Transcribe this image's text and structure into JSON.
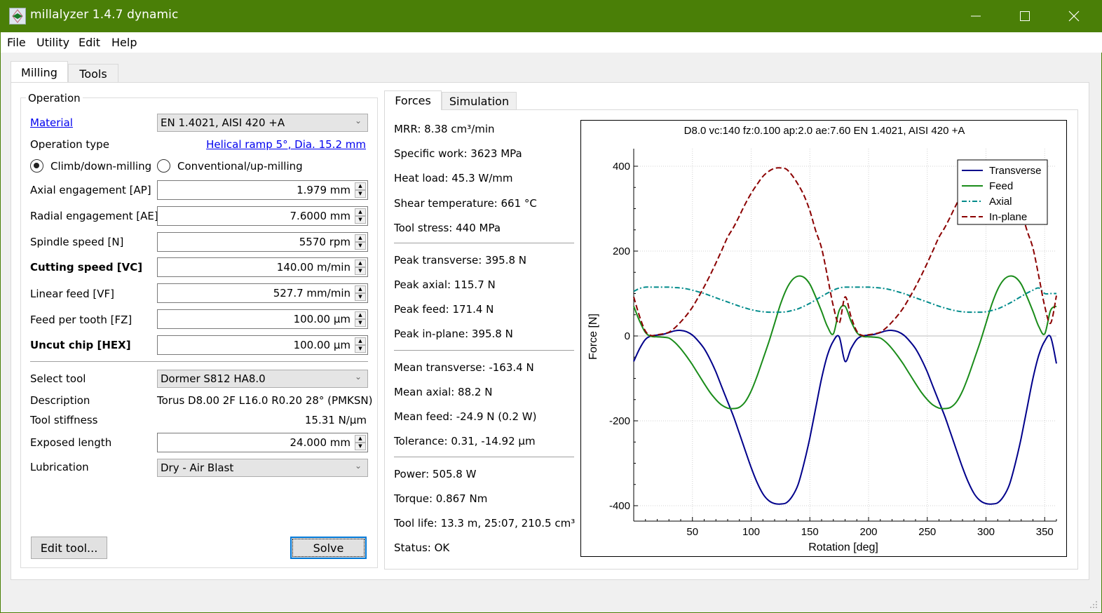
{
  "window": {
    "title": "millalyzer 1.4.7 dynamic",
    "controls": [
      "minimize",
      "maximize",
      "close"
    ]
  },
  "menu": [
    "File",
    "Utility",
    "Edit",
    "Help"
  ],
  "main_tabs": [
    {
      "label": "Milling",
      "active": true
    },
    {
      "label": "Tools",
      "active": false
    }
  ],
  "operation": {
    "group_title": "Operation",
    "material_label": "Material",
    "material_value": "EN 1.4021, AISI 420 +A",
    "operation_type_label": "Operation type",
    "operation_type_link": "Helical ramp 5°, Dia. 15.2 mm",
    "radios": [
      {
        "label": "Climb/down-milling",
        "checked": true
      },
      {
        "label": "Conventional/up-milling",
        "checked": false
      }
    ],
    "fields": [
      {
        "label": "Axial engagement [AP]",
        "value": "1.979 mm",
        "bold": false
      },
      {
        "label": "Radial engagement [AE]",
        "value": "7.6000 mm",
        "bold": false
      },
      {
        "label": "Spindle speed [N]",
        "value": "5570 rpm",
        "bold": false
      },
      {
        "label": "Cutting speed [VC]",
        "value": "140.00 m/min",
        "bold": true
      },
      {
        "label": "Linear feed [VF]",
        "value": "527.7 mm/min",
        "bold": false
      },
      {
        "label": "Feed per tooth [FZ]",
        "value": "100.00 µm",
        "bold": false
      },
      {
        "label": "Uncut chip [HEX]",
        "value": "100.00 µm",
        "bold": true
      }
    ],
    "select_tool_label": "Select tool",
    "select_tool_value": "Dormer S812 HA8.0",
    "description_label": "Description",
    "description_value": "Torus D8.00 2F L16.0 R0.20 28° (PMKSN)",
    "stiffness_label": "Tool stiffness",
    "stiffness_value": "15.31 N/µm",
    "exposed_label": "Exposed length",
    "exposed_value": "24.000 mm",
    "lubrication_label": "Lubrication",
    "lubrication_value": "Dry - Air Blast",
    "edit_tool_button": "Edit tool...",
    "solve_button": "Solve"
  },
  "result_tabs": [
    {
      "label": "Forces",
      "active": true
    },
    {
      "label": "Simulation",
      "active": false
    }
  ],
  "stats": {
    "group1": [
      "MRR: 8.38 cm³/min",
      "Specific work: 3623 MPa",
      "Heat load: 45.3 W/mm",
      "Shear temperature: 661 °C",
      "Tool stress: 440 MPa"
    ],
    "group2": [
      "Peak transverse: 395.8 N",
      "Peak axial: 115.7 N",
      "Peak feed: 171.4 N",
      "Peak in-plane: 395.8 N"
    ],
    "group3": [
      "Mean transverse: -163.4 N",
      "Mean axial: 88.2 N",
      "Mean feed: -24.9 N (0.2 W)",
      "Tolerance: 0.31, -14.92 µm"
    ],
    "group4": [
      "Power: 505.8 W",
      "Torque: 0.867 Nm",
      "Tool life: 13.3 m, 25:07, 210.5 cm³",
      "Status: OK"
    ]
  },
  "chart_data": {
    "type": "line",
    "title": "D8.0 vc:140 fz:0.100 ap:2.0 ae:7.60 EN 1.4021, AISI 420 +A",
    "xlabel": "Rotation [deg]",
    "ylabel": "Force [N]",
    "xlim": [
      0,
      360
    ],
    "ylim": [
      -430,
      440
    ],
    "xticks": [
      50,
      100,
      150,
      200,
      250,
      300,
      350
    ],
    "yticks": [
      -400,
      -200,
      0,
      200,
      400
    ],
    "grid": true,
    "legend_position": "top-right",
    "x": [
      0,
      5,
      10,
      15,
      20,
      25,
      30,
      35,
      40,
      45,
      50,
      55,
      60,
      65,
      70,
      75,
      80,
      85,
      90,
      95,
      100,
      105,
      110,
      115,
      120,
      125,
      130,
      135,
      140,
      145,
      150,
      155,
      160,
      165,
      170,
      175,
      180,
      185,
      190,
      195,
      200,
      205,
      210,
      215,
      220,
      225,
      230,
      235,
      240,
      245,
      250,
      255,
      260,
      265,
      270,
      275,
      280,
      285,
      290,
      295,
      300,
      305,
      310,
      315,
      320,
      325,
      330,
      335,
      340,
      345,
      350,
      355,
      360
    ],
    "series": [
      {
        "name": "Transverse",
        "color": "#00008b",
        "dash": "solid",
        "values": [
          -60,
          -30,
          -8,
          0,
          2,
          4,
          8,
          12,
          13,
          10,
          2,
          -12,
          -30,
          -55,
          -85,
          -120,
          -155,
          -190,
          -230,
          -270,
          -310,
          -345,
          -372,
          -388,
          -395,
          -396,
          -393,
          -378,
          -350,
          -300,
          -240,
          -170,
          -100,
          -45,
          -12,
          -2,
          -60,
          -30,
          -8,
          0,
          2,
          4,
          8,
          12,
          13,
          10,
          2,
          -12,
          -30,
          -55,
          -85,
          -120,
          -155,
          -190,
          -230,
          -270,
          -310,
          -345,
          -372,
          -388,
          -395,
          -396,
          -393,
          -378,
          -350,
          -300,
          -240,
          -170,
          -100,
          -45,
          -12,
          -2,
          -65
        ]
      },
      {
        "name": "Feed",
        "color": "#1a8c1a",
        "dash": "solid",
        "values": [
          70,
          35,
          8,
          -1,
          -2,
          -3,
          -5,
          -15,
          -30,
          -48,
          -68,
          -90,
          -112,
          -133,
          -150,
          -163,
          -170,
          -171,
          -168,
          -155,
          -130,
          -95,
          -55,
          -15,
          30,
          75,
          110,
          132,
          141,
          138,
          122,
          92,
          58,
          22,
          5,
          60,
          70,
          35,
          8,
          -1,
          -2,
          -3,
          -5,
          -15,
          -30,
          -48,
          -68,
          -90,
          -112,
          -133,
          -150,
          -163,
          -170,
          -171,
          -168,
          -155,
          -130,
          -95,
          -55,
          -15,
          30,
          75,
          110,
          132,
          141,
          138,
          122,
          92,
          58,
          22,
          5,
          60,
          70
        ]
      },
      {
        "name": "Axial",
        "color": "#008b8b",
        "dash": "dashdot",
        "values": [
          105,
          112,
          115,
          115,
          115,
          115,
          115,
          114,
          113,
          111,
          108,
          104,
          100,
          95,
          90,
          85,
          80,
          75,
          70,
          66,
          62,
          59,
          57,
          56,
          56,
          56,
          57,
          60,
          64,
          70,
          77,
          85,
          93,
          101,
          108,
          113,
          115,
          115,
          115,
          115,
          115,
          114,
          113,
          111,
          108,
          104,
          100,
          95,
          90,
          85,
          80,
          75,
          70,
          66,
          62,
          59,
          57,
          56,
          56,
          56,
          57,
          60,
          64,
          70,
          77,
          85,
          93,
          101,
          108,
          113,
          100,
          100,
          100
        ]
      },
      {
        "name": "In-plane",
        "color": "#8b0000",
        "dash": "dashed",
        "values": [
          92,
          46,
          11,
          1,
          3,
          5,
          9,
          19,
          33,
          49,
          68,
          91,
          116,
          143,
          172,
          202,
          233,
          256,
          283,
          311,
          336,
          357,
          376,
          388,
          395,
          396,
          393,
          378,
          357,
          331,
          295,
          248,
          207,
          140,
          70,
          30,
          92,
          46,
          11,
          1,
          3,
          5,
          9,
          19,
          33,
          49,
          68,
          91,
          116,
          143,
          172,
          202,
          233,
          256,
          283,
          311,
          336,
          357,
          376,
          388,
          395,
          396,
          393,
          378,
          357,
          331,
          295,
          248,
          207,
          140,
          70,
          30,
          95
        ]
      }
    ]
  }
}
